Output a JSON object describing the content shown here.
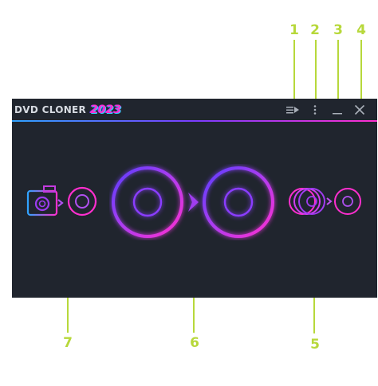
{
  "app": {
    "title": "DVD CLONER",
    "year": "2023"
  },
  "callouts": [
    "1",
    "2",
    "3",
    "4",
    "5",
    "6",
    "7"
  ],
  "window_controls": [
    {
      "name": "playlist-menu",
      "icon": "playlist-play-icon"
    },
    {
      "name": "more-options",
      "icon": "vertical-dots-icon"
    },
    {
      "name": "minimize",
      "icon": "minimize-icon"
    },
    {
      "name": "close",
      "icon": "close-icon"
    }
  ],
  "tools": [
    {
      "name": "camera-to-disc",
      "icon": "camera-to-disc-icon"
    },
    {
      "name": "disc-to-disc-clone",
      "icon": "disc-clone-icon"
    },
    {
      "name": "multi-disc-to-disc",
      "icon": "multi-disc-icon"
    }
  ],
  "colors": {
    "callout": "#b7d83b",
    "window_bg": "#20252e",
    "neon_pink": "#ff2fcf",
    "neon_purple": "#7b3cff",
    "neon_blue": "#2fa3ff"
  }
}
